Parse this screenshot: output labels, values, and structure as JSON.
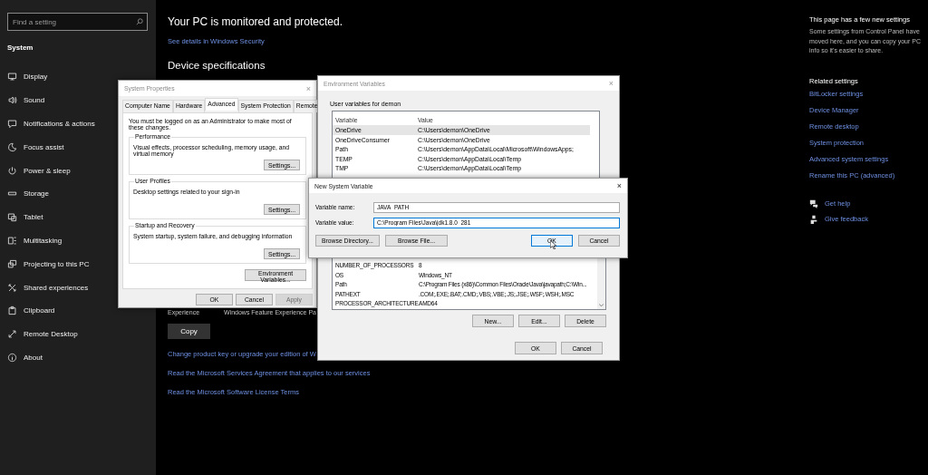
{
  "sidebar": {
    "search": {
      "placeholder": "Find a setting"
    },
    "section": "System",
    "items": [
      {
        "label": "Display"
      },
      {
        "label": "Sound"
      },
      {
        "label": "Notifications & actions"
      },
      {
        "label": "Focus assist"
      },
      {
        "label": "Power & sleep"
      },
      {
        "label": "Storage"
      },
      {
        "label": "Tablet"
      },
      {
        "label": "Multitasking"
      },
      {
        "label": "Projecting to this PC"
      },
      {
        "label": "Shared experiences"
      },
      {
        "label": "Clipboard"
      },
      {
        "label": "Remote Desktop"
      },
      {
        "label": "About"
      }
    ]
  },
  "main": {
    "status": "Your PC is monitored and protected.",
    "security_link": "See details in Windows Security",
    "specs_heading": "Device specifications",
    "experience": {
      "label": "Experience",
      "value": "Windows Feature Experience Pa"
    },
    "copy_button": "Copy",
    "links": [
      "Change product key or upgrade your edition of W",
      "Read the Microsoft Services Agreement that applies to our services",
      "Read the Microsoft Software License Terms"
    ]
  },
  "right_panel": {
    "heading": "This page has a few new settings",
    "description": "Some settings from Control Panel have moved here, and you can copy your PC info so it's easier to share.",
    "related_heading": "Related settings",
    "related_links": [
      "BitLocker settings",
      "Device Manager",
      "Remote desktop",
      "System protection",
      "Advanced system settings",
      "Rename this PC (advanced)"
    ],
    "help_links": [
      "Get help",
      "Give feedback"
    ]
  },
  "system_properties": {
    "title": "System Properties",
    "close": "×",
    "tabs": [
      {
        "label": "Computer Name",
        "selected": false
      },
      {
        "label": "Hardware",
        "selected": false
      },
      {
        "label": "Advanced",
        "selected": true
      },
      {
        "label": "System Protection",
        "selected": false
      },
      {
        "label": "Remote",
        "selected": false
      }
    ],
    "notice": "You must be logged on as an Administrator to make most of these changes.",
    "groups": [
      {
        "title": "Performance",
        "text": "Visual effects, processor scheduling, memory usage, and virtual memory",
        "button": "Settings..."
      },
      {
        "title": "User Profiles",
        "text": "Desktop settings related to your sign-in",
        "button": "Settings..."
      },
      {
        "title": "Startup and Recovery",
        "text": "System startup, system failure, and debugging information",
        "button": "Settings..."
      }
    ],
    "env_button": "Environment Variables...",
    "buttons": [
      {
        "label": "OK",
        "disabled": false
      },
      {
        "label": "Cancel",
        "disabled": false
      },
      {
        "label": "Apply",
        "disabled": true
      }
    ]
  },
  "environment_variables": {
    "title": "Environment Variables",
    "close": "×",
    "user_heading": "User variables for demon",
    "user_columns": [
      "Variable",
      "Value"
    ],
    "user_rows": [
      {
        "variable": "OneDrive",
        "value": "C:\\Users\\demon\\OneDrive",
        "selected": true
      },
      {
        "variable": "OneDriveConsumer",
        "value": "C:\\Users\\demon\\OneDrive",
        "selected": false
      },
      {
        "variable": "Path",
        "value": "C:\\Users\\demon\\AppData\\Local\\Microsoft\\WindowsApps;",
        "selected": false
      },
      {
        "variable": "TEMP",
        "value": "C:\\Users\\demon\\AppData\\Local\\Temp",
        "selected": false
      },
      {
        "variable": "TMP",
        "value": "C:\\Users\\demon\\AppData\\Local\\Temp",
        "selected": false
      }
    ],
    "system_rows": [
      {
        "variable": "NUMBER_OF_PROCESSORS",
        "value": "8"
      },
      {
        "variable": "OS",
        "value": "Windows_NT"
      },
      {
        "variable": "Path",
        "value": "C:\\Program Files (x86)\\Common Files\\Oracle\\Java\\javapath;C:\\Win..."
      },
      {
        "variable": "PATHEXT",
        "value": ".COM;.EXE;.BAT;.CMD;.VBS;.VBE;.JS;.JSE;.WSF;.WSH;.MSC"
      },
      {
        "variable": "PROCESSOR_ARCHITECTURE",
        "value": "AMD64"
      }
    ],
    "system_buttons": [
      "New...",
      "Edit...",
      "Delete"
    ],
    "buttons": [
      "OK",
      "Cancel"
    ]
  },
  "new_system_variable": {
    "title": "New System Variable",
    "close": "×",
    "fields": [
      {
        "label": "Variable name:",
        "value": "JAVA_PATH",
        "focused": false
      },
      {
        "label": "Variable value:",
        "value": "C:\\Program Files\\Java\\jdk1.8.0_281",
        "focused": true
      }
    ],
    "browse_buttons": [
      "Browse Directory...",
      "Browse File..."
    ],
    "buttons": [
      {
        "label": "OK",
        "default": true
      },
      {
        "label": "Cancel",
        "default": false
      }
    ]
  }
}
